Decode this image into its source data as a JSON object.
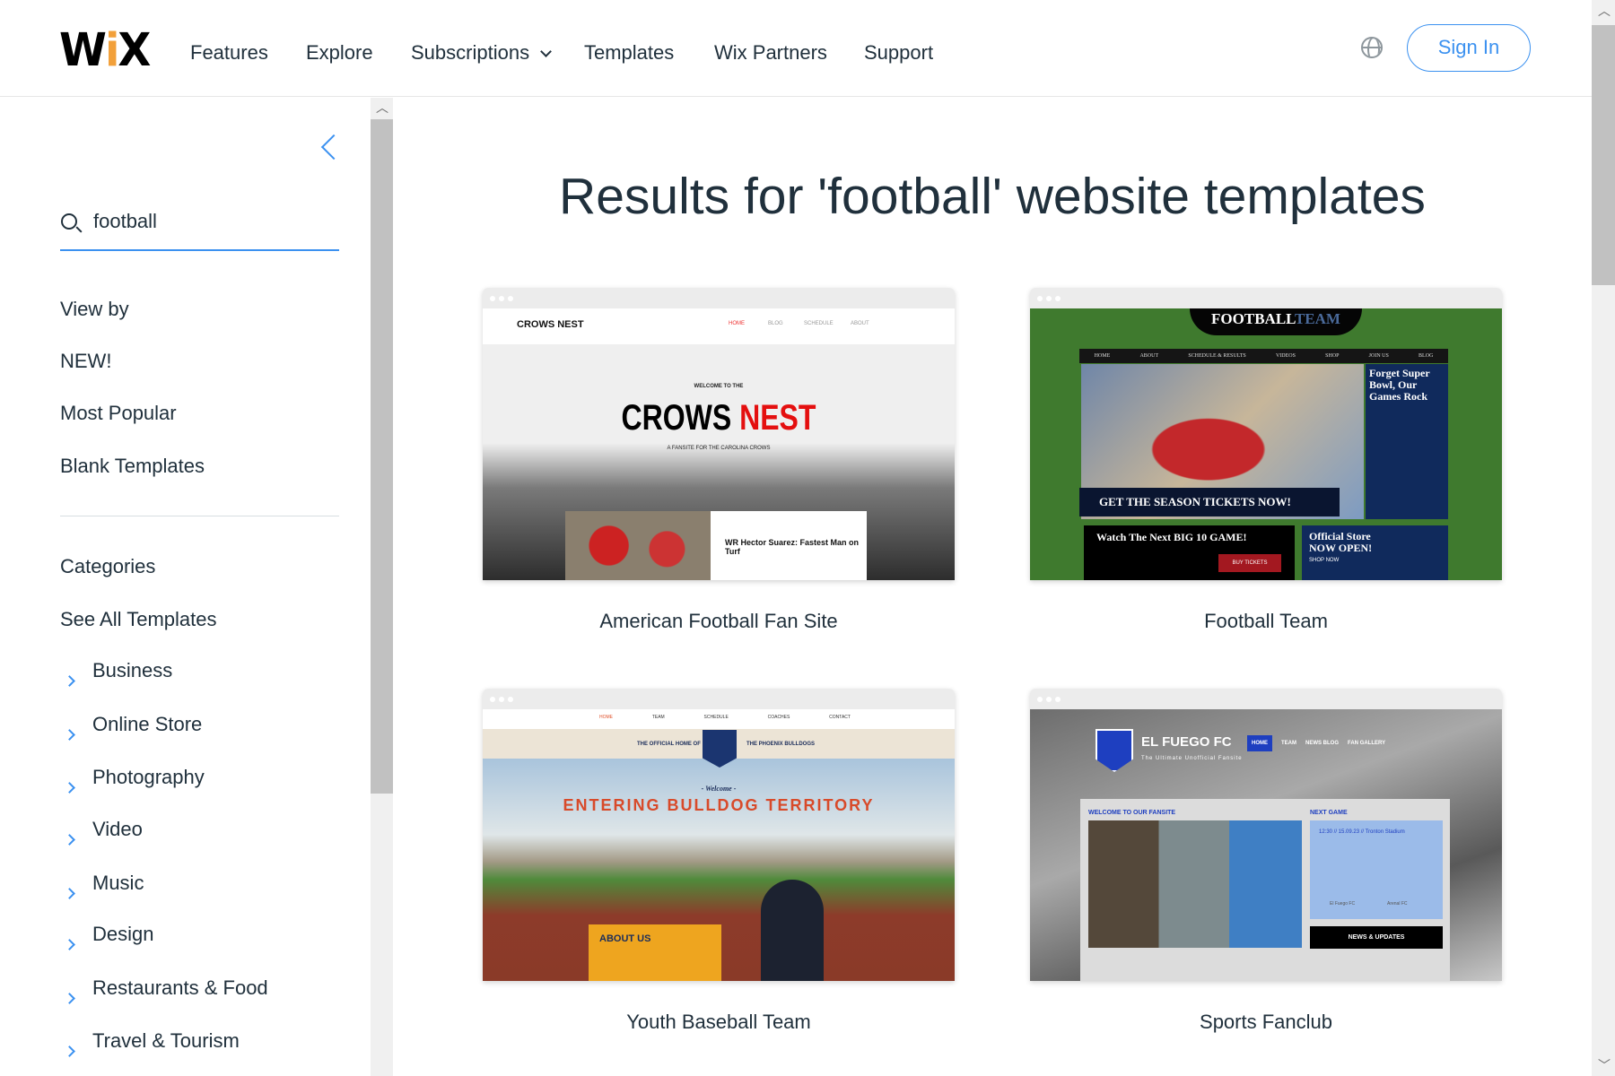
{
  "header": {
    "logo": "WiX",
    "nav": [
      {
        "label": "Features"
      },
      {
        "label": "Explore"
      },
      {
        "label": "Subscriptions",
        "has_dropdown": true
      },
      {
        "label": "Templates"
      },
      {
        "label": "Wix Partners"
      },
      {
        "label": "Support"
      }
    ],
    "language_icon": "globe-icon",
    "sign_in": "Sign In"
  },
  "sidebar": {
    "back_icon": "chevron-left-icon",
    "search": {
      "value": "football",
      "icon": "search-icon"
    },
    "view_by": {
      "heading": "View by",
      "items": [
        "NEW!",
        "Most Popular",
        "Blank Templates"
      ]
    },
    "categories": {
      "heading": "Categories",
      "see_all": "See All Templates",
      "items": [
        "Business",
        "Online Store",
        "Photography",
        "Video",
        "Music",
        "Design",
        "Restaurants & Food",
        "Travel & Tourism"
      ]
    }
  },
  "main": {
    "title": "Results for 'football' website templates",
    "templates": [
      {
        "name": "American Football Fan Site",
        "preview": {
          "brand": "CROWS NEST",
          "nav": [
            "HOME",
            "BLOG",
            "SCHEDULE",
            "ABOUT"
          ],
          "kicker": "WELCOME TO THE",
          "headline_a": "CROWS",
          "headline_b": "NEST",
          "subtitle": "A FANSITE FOR THE CAROLINA CROWS",
          "post_title": "WR Hector Suarez: Fastest Man on Turf"
        }
      },
      {
        "name": "Football Team",
        "preview": {
          "brand_a": "FOOTBALL",
          "brand_b": "TEAM",
          "nav": [
            "HOME",
            "ABOUT",
            "SCHEDULE & RESULTS",
            "VIDEOS",
            "SHOP",
            "JOIN US",
            "BLOG"
          ],
          "side_heading": "Forget Super Bowl, Our Games Rock",
          "banner": "GET THE SEASON TICKETS NOW!",
          "promo": "Watch The Next BIG 10 GAME!",
          "buy": "BUY TICKETS",
          "store": "Official Store NOW OPEN!",
          "shop": "SHOP NOW"
        }
      },
      {
        "name": "Youth Baseball Team",
        "preview": {
          "nav": [
            "HOME",
            "TEAM",
            "SCHEDULE",
            "COACHES",
            "CONTACT"
          ],
          "left": "THE OFFICIAL HOME OF",
          "right": "THE PHOENIX BULLDOGS",
          "welcome": "- Welcome -",
          "headline": "ENTERING BULLDOG TERRITORY",
          "about": "ABOUT US"
        }
      },
      {
        "name": "Sports Fanclub",
        "preview": {
          "brand": "EL FUEGO FC",
          "tagline": "The Ultimate Unofficial Fansite",
          "nav": [
            "HOME",
            "TEAM",
            "NEWS BLOG",
            "FAN GALLERY"
          ],
          "welcome": "WELCOME TO OUR FANSITE",
          "next": "NEXT GAME",
          "game": "12:30 // 15.09.23 // Tronton Stadium",
          "teams": [
            "El Fuego FC",
            "Arenal FC"
          ],
          "news": "NEWS & UPDATES"
        }
      }
    ]
  },
  "colors": {
    "accent": "#3b91f0",
    "text": "#20303c"
  }
}
